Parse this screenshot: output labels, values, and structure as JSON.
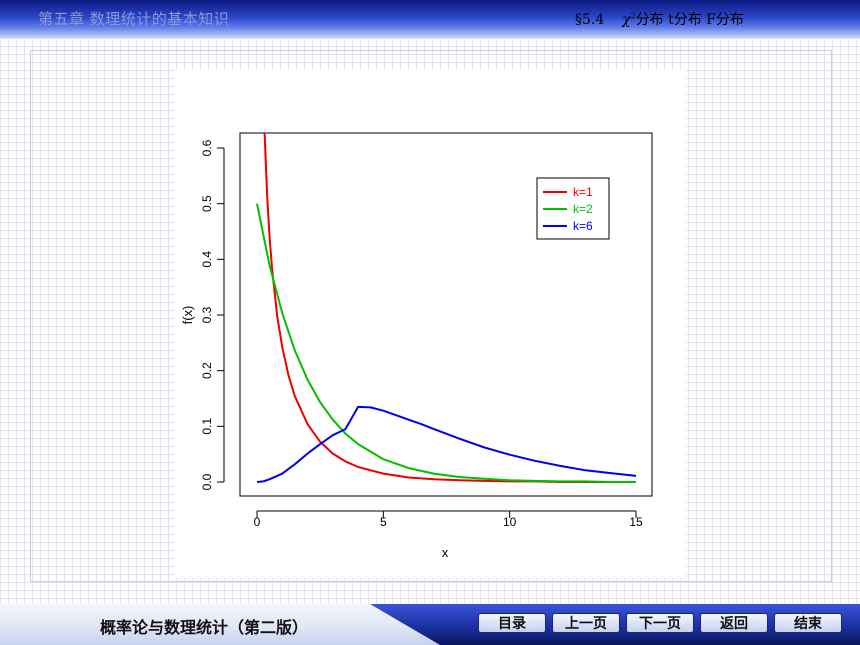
{
  "header": {
    "chapter": "第五章    数理统计的基本知识",
    "section_num": "§5.4",
    "section_chi": "χ",
    "section_sup": "2",
    "section_rest": "分布  t分布  F分布"
  },
  "footer": {
    "book_title": "概率论与数理统计（第二版）",
    "nav": [
      "目录",
      "上一页",
      "下一页",
      "返回",
      "结束"
    ]
  },
  "colors": {
    "k1": "#ee0000",
    "k2": "#00c000",
    "k6": "#0000ee"
  },
  "chart_data": {
    "type": "line",
    "title": "",
    "xlabel": "x",
    "ylabel": "f(x)",
    "xlim": [
      0,
      15
    ],
    "ylim": [
      0,
      0.6
    ],
    "xticks": [
      0,
      5,
      10,
      15
    ],
    "yticks": [
      0.0,
      0.1,
      0.2,
      0.3,
      0.4,
      0.5,
      0.6
    ],
    "xtick_labels": [
      "0",
      "5",
      "10",
      "15"
    ],
    "ytick_labels": [
      "0.0",
      "0.1",
      "0.2",
      "0.3",
      "0.4",
      "0.5",
      "0.6"
    ],
    "legend_position": "top-right",
    "grid": false,
    "series": [
      {
        "name": "k=1",
        "color": "#ee0000",
        "x": [
          0.3,
          0.4,
          0.5,
          0.6,
          0.8,
          1,
          1.25,
          1.5,
          2,
          2.5,
          3,
          3.5,
          4,
          5,
          6,
          7,
          8,
          9,
          10,
          11,
          12,
          13,
          14,
          15
        ],
        "y": [
          0.627,
          0.516,
          0.439,
          0.381,
          0.298,
          0.242,
          0.191,
          0.154,
          0.104,
          0.072,
          0.051,
          0.037,
          0.027,
          0.015,
          0.008,
          0.005,
          0.003,
          0.002,
          0.001,
          0.001,
          0.0,
          0.0,
          0.0,
          0.0
        ]
      },
      {
        "name": "k=2",
        "color": "#00c000",
        "x": [
          0,
          0.5,
          1,
          1.5,
          2,
          2.5,
          3,
          3.5,
          4,
          5,
          6,
          7,
          8,
          9,
          10,
          11,
          12,
          13,
          14,
          15
        ],
        "y": [
          0.5,
          0.389,
          0.303,
          0.236,
          0.184,
          0.143,
          0.112,
          0.087,
          0.068,
          0.041,
          0.025,
          0.015,
          0.009,
          0.006,
          0.003,
          0.002,
          0.001,
          0.001,
          0.0,
          0.0
        ]
      },
      {
        "name": "k=6",
        "color": "#0000ee",
        "x": [
          0,
          0.25,
          0.5,
          0.75,
          1,
          1.5,
          2,
          2.5,
          3,
          3.5,
          4,
          4.5,
          5,
          5.5,
          6,
          6.5,
          7,
          8,
          9,
          10,
          11,
          12,
          13,
          14,
          15
        ],
        "y": [
          0.0,
          0.001,
          0.005,
          0.01,
          0.015,
          0.032,
          0.051,
          0.068,
          0.084,
          0.095,
          0.135,
          0.134,
          0.128,
          0.12,
          0.112,
          0.104,
          0.095,
          0.078,
          0.062,
          0.049,
          0.038,
          0.029,
          0.021,
          0.016,
          0.011
        ]
      }
    ]
  }
}
